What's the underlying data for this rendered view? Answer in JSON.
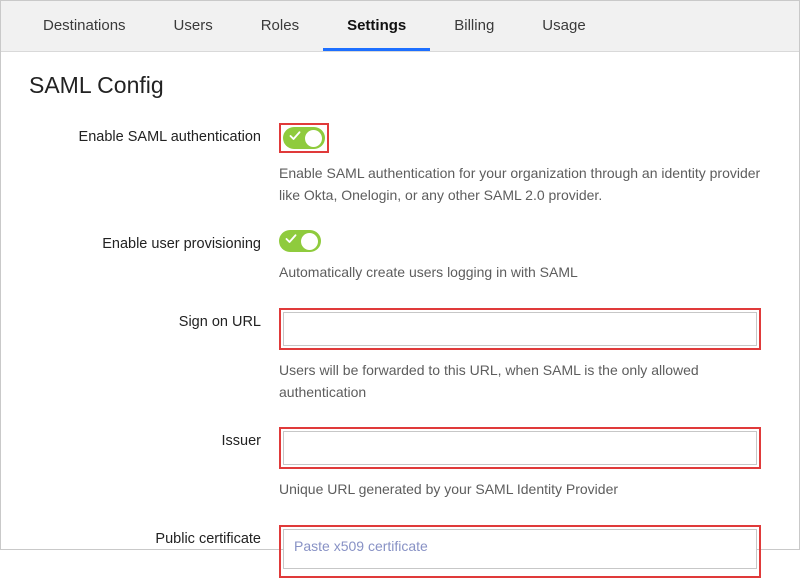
{
  "tabs": [
    {
      "label": "Destinations",
      "active": false
    },
    {
      "label": "Users",
      "active": false
    },
    {
      "label": "Roles",
      "active": false
    },
    {
      "label": "Settings",
      "active": true
    },
    {
      "label": "Billing",
      "active": false
    },
    {
      "label": "Usage",
      "active": false
    }
  ],
  "title": "SAML Config",
  "fields": {
    "enable_saml": {
      "label": "Enable SAML authentication",
      "helper": "Enable SAML authentication for your organization through an identity provider like Okta, Onelogin, or any other SAML 2.0 provider.",
      "value": true
    },
    "enable_provisioning": {
      "label": "Enable user provisioning",
      "helper": "Automatically create users logging in with SAML",
      "value": true
    },
    "sign_on_url": {
      "label": "Sign on URL",
      "helper": "Users will be forwarded to this URL, when SAML is the only allowed authentication",
      "value": "",
      "placeholder": ""
    },
    "issuer": {
      "label": "Issuer",
      "helper": "Unique URL generated by your SAML Identity Provider",
      "value": "",
      "placeholder": ""
    },
    "public_certificate": {
      "label": "Public certificate",
      "value": "",
      "placeholder": "Paste x509 certificate"
    }
  },
  "colors": {
    "accent_blue": "#1d6fff",
    "toggle_green": "#8fcb3d",
    "highlight_red": "#e03a3a"
  }
}
